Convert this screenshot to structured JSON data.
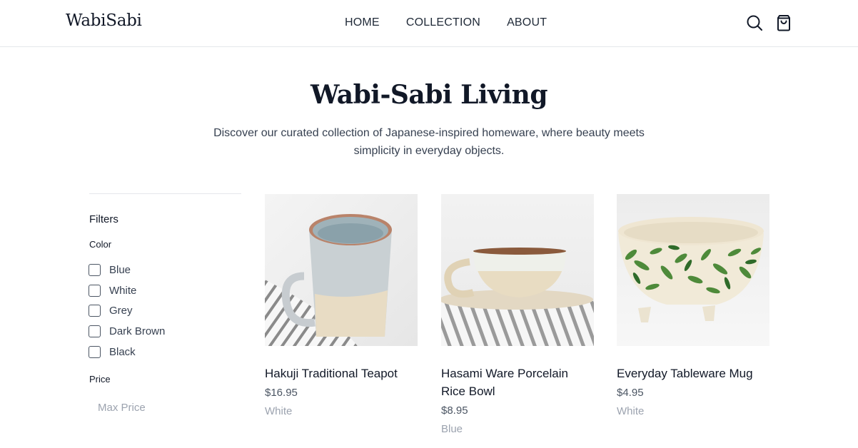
{
  "header": {
    "logo": "WabiSabi",
    "nav": [
      "HOME",
      "COLLECTION",
      "ABOUT"
    ],
    "icons": [
      "search-icon",
      "shopping-bag-icon"
    ]
  },
  "hero": {
    "title": "Wabi-Sabi Living",
    "subtitle": "Discover our curated collection of Japanese-inspired homeware, where beauty meets simplicity in everyday objects."
  },
  "filters": {
    "title": "Filters",
    "color_label": "Color",
    "colors": [
      "Blue",
      "White",
      "Grey",
      "Dark Brown",
      "Black"
    ],
    "price_label": "Price",
    "price_placeholder": "Max Price"
  },
  "products": [
    {
      "name": "Hakuji Traditional Teapot",
      "price": "$16.95",
      "variant": "White"
    },
    {
      "name": "Hasami Ware Porcelain Rice Bowl",
      "price": "$8.95",
      "variant": "Blue"
    },
    {
      "name": "Everyday Tableware Mug",
      "price": "$4.95",
      "variant": "White"
    }
  ],
  "colors": {
    "text": "#111827",
    "muted": "#9ca3af",
    "border": "#e5e7eb"
  }
}
